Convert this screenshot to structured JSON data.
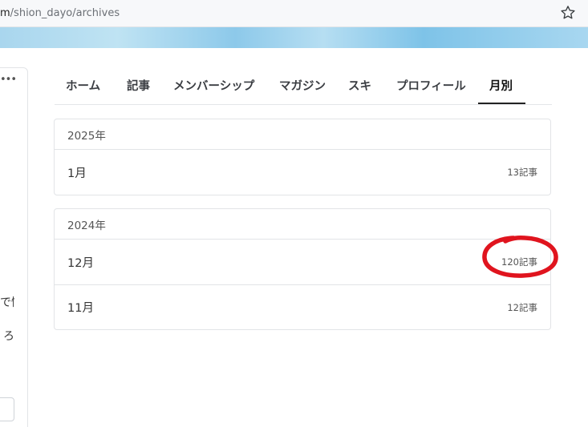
{
  "browser": {
    "url_domain_fragment": "m",
    "url_path": "/shion_dayo/archives"
  },
  "sidebar": {
    "more_icon": "more-horizontal-icon",
    "text_line_1": "で情",
    "text_line_2": "ろ"
  },
  "tabs": [
    {
      "label": "ホーム",
      "active": false
    },
    {
      "label": "記事",
      "active": false
    },
    {
      "label": "メンバーシップ",
      "active": false
    },
    {
      "label": "マガジン",
      "active": false
    },
    {
      "label": "スキ",
      "active": false
    },
    {
      "label": "プロフィール",
      "active": false
    },
    {
      "label": "月別",
      "active": true
    }
  ],
  "archives": [
    {
      "year": "2025年",
      "months": [
        {
          "label": "1月",
          "count": "13記事"
        }
      ]
    },
    {
      "year": "2024年",
      "months": [
        {
          "label": "12月",
          "count": "120記事"
        },
        {
          "label": "11月",
          "count": "12記事"
        }
      ]
    }
  ],
  "colors": {
    "annotation": "#e0141e",
    "accent": "#222222"
  }
}
